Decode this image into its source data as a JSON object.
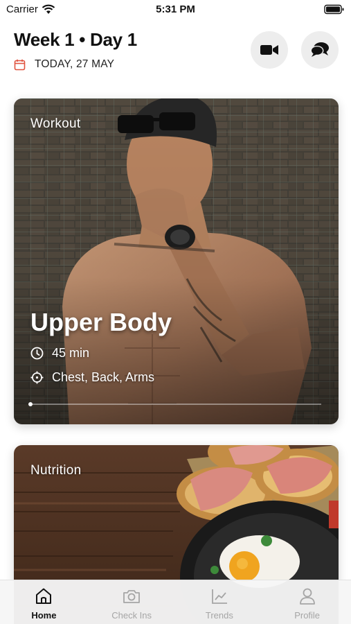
{
  "status_bar": {
    "carrier": "Carrier",
    "time": "5:31 PM"
  },
  "header": {
    "title": "Week 1 • Day 1",
    "date": "TODAY, 27 MAY"
  },
  "actions": {
    "video_icon": "video-camera-icon",
    "chat_icon": "chat-bubbles-icon"
  },
  "workout_card": {
    "label": "Workout",
    "title": "Upper Body",
    "duration": "45 min",
    "muscles": "Chest, Back, Arms",
    "progress": 0
  },
  "nutrition_card": {
    "label": "Nutrition"
  },
  "tab_bar": {
    "tabs": [
      {
        "label": "Home",
        "icon": "home-icon",
        "active": true
      },
      {
        "label": "Check Ins",
        "icon": "camera-icon",
        "active": false
      },
      {
        "label": "Trends",
        "icon": "chart-icon",
        "active": false
      },
      {
        "label": "Profile",
        "icon": "person-icon",
        "active": false
      }
    ]
  },
  "colors": {
    "accent": "#e0533f",
    "inactive_tab": "#a5a5a5",
    "button_bg": "#ededed"
  }
}
